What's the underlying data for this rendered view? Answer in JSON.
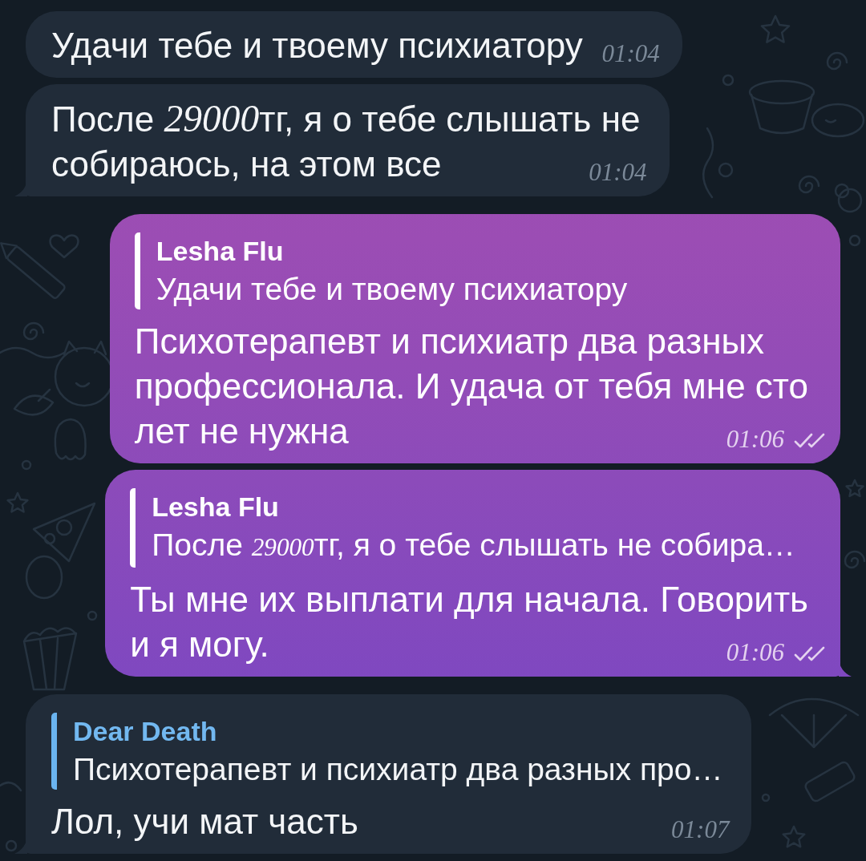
{
  "messages": [
    {
      "kind": "incoming",
      "tail": false,
      "lines": [
        "Удачи тебе и твоему психиатору"
      ],
      "time": "01:04"
    },
    {
      "kind": "incoming",
      "tail": true,
      "lines": [
        [
          {
            "text": "После ",
            "italic": false
          },
          {
            "text": "29000",
            "italic": true
          },
          {
            "text": "тг, я о тебе слышать не",
            "italic": false
          }
        ],
        "собираюсь, на этом все"
      ],
      "time": "01:04"
    },
    {
      "kind": "outgoing",
      "tail": false,
      "reply": {
        "author": "Lesha Flu",
        "text": "Удачи тебе и твоему психиатору"
      },
      "lines": [
        "Психотерапевт и психиатр два разных",
        "профессионала. И удача от тебя мне сто",
        "лет не нужна"
      ],
      "time": "01:06",
      "read": true
    },
    {
      "kind": "outgoing",
      "tail": true,
      "reply": {
        "author": "Lesha Flu",
        "text": [
          {
            "text": "После ",
            "italic": false
          },
          {
            "text": "29000",
            "italic": true
          },
          {
            "text": "тг, я о тебе слышать не собира…",
            "italic": false
          }
        ]
      },
      "lines": [
        "Ты мне их выплати для начала. Говорить",
        "и я могу."
      ],
      "time": "01:06",
      "read": true
    },
    {
      "kind": "incoming",
      "tail": true,
      "reply": {
        "author": "Dear Death",
        "text": "Психотерапевт и психиатр два разных про…"
      },
      "lines": [
        "Лол, учи мат часть"
      ],
      "time": "01:07"
    }
  ]
}
